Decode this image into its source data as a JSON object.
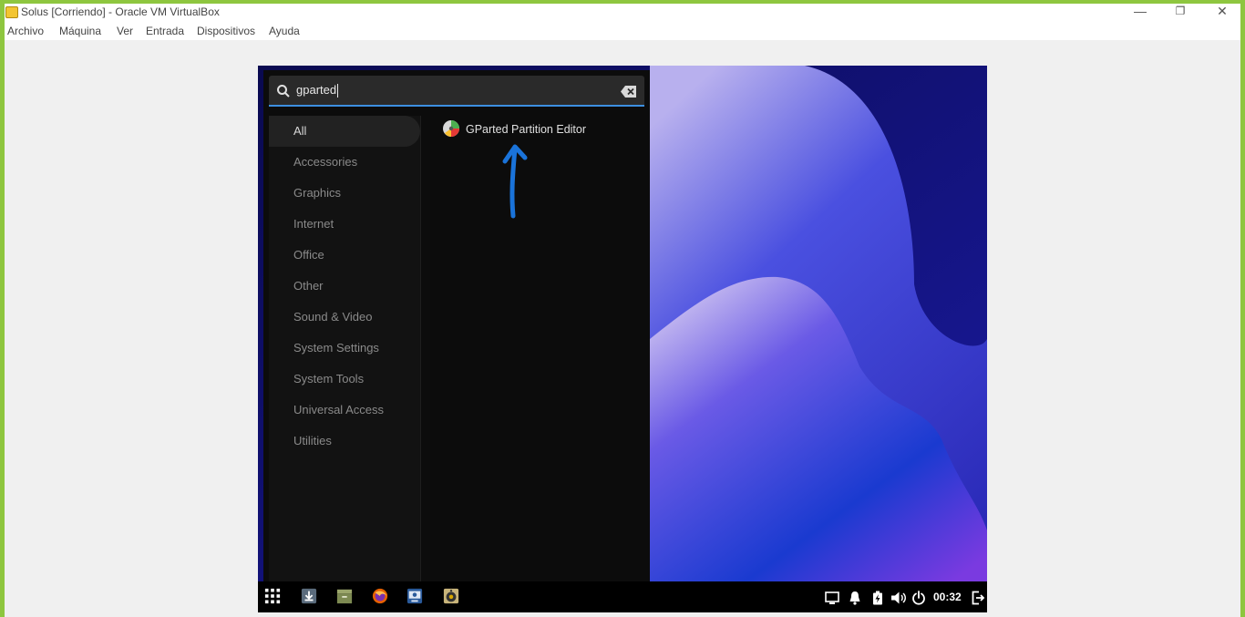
{
  "window": {
    "title": "Solus [Corriendo] - Oracle VM VirtualBox",
    "controls": {
      "minimize": "—",
      "restore": "❐",
      "close": "✕"
    }
  },
  "menubar": {
    "items": [
      "Archivo",
      "Máquina",
      "Ver",
      "Entrada",
      "Dispositivos",
      "Ayuda"
    ]
  },
  "app_menu": {
    "search": {
      "value": "gparted"
    },
    "categories": [
      {
        "label": "All",
        "active": true
      },
      {
        "label": "Accessories"
      },
      {
        "label": "Graphics"
      },
      {
        "label": "Internet"
      },
      {
        "label": "Office"
      },
      {
        "label": "Other"
      },
      {
        "label": "Sound & Video"
      },
      {
        "label": "System Settings"
      },
      {
        "label": "System Tools"
      },
      {
        "label": "Universal Access"
      },
      {
        "label": "Utilities"
      }
    ],
    "results": [
      {
        "label": "GParted Partition Editor",
        "icon": "gparted-icon"
      }
    ]
  },
  "panel": {
    "launchers": [
      "app-grid-icon",
      "download-icon",
      "files-icon",
      "firefox-icon",
      "software-center-icon",
      "rhythmbox-icon"
    ],
    "tray": [
      "display-icon",
      "notifications-icon",
      "battery-icon",
      "volume-icon",
      "power-icon"
    ],
    "clock": "00:32",
    "end_icon": "logout-icon"
  },
  "colors": {
    "window_border": "#8ec63f",
    "accent": "#3d8fe0",
    "annotation_arrow": "#1a73d9"
  }
}
